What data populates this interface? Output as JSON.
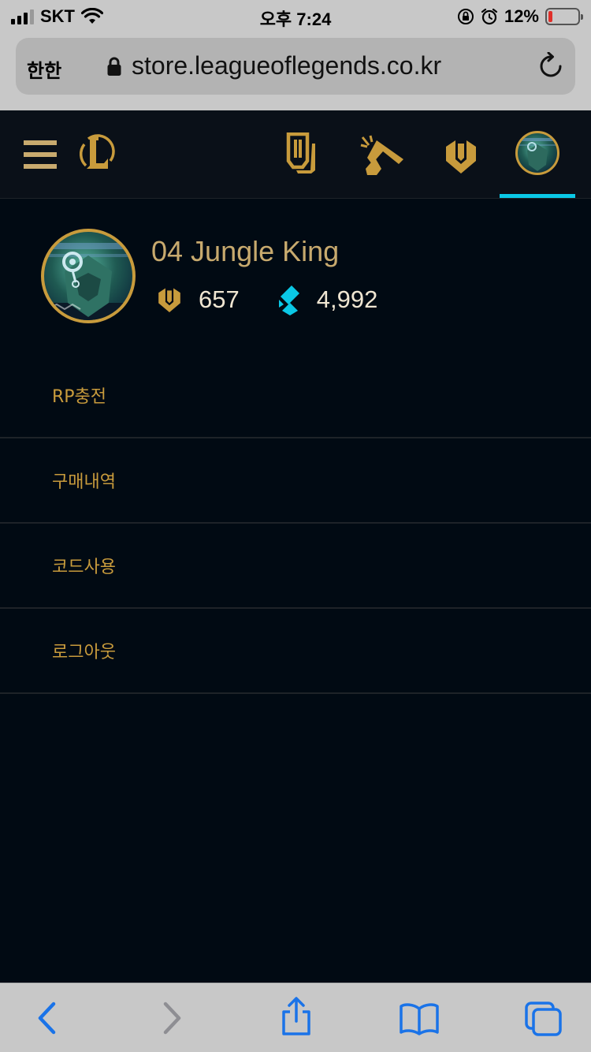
{
  "status_bar": {
    "carrier": "SKT",
    "time": "오후 7:24",
    "battery_percent": "12%",
    "battery_level": 0.12
  },
  "browser": {
    "text_size_label": "한한",
    "url": "store.leagueoflegends.co.kr"
  },
  "nav": {
    "items": [
      {
        "icon": "menu-icon"
      },
      {
        "icon": "league-logo-icon"
      },
      {
        "icon": "collection-icon"
      },
      {
        "icon": "hextech-crafting-icon"
      },
      {
        "icon": "rp-icon"
      },
      {
        "icon": "profile-avatar-icon",
        "active": true
      }
    ]
  },
  "profile": {
    "username": "04 Jungle King",
    "rp": "657",
    "essence": "4,992"
  },
  "menu": {
    "items": [
      {
        "label": "RP충전"
      },
      {
        "label": "구매내역"
      },
      {
        "label": "코드사용"
      },
      {
        "label": "로그아웃"
      }
    ]
  },
  "colors": {
    "gold": "#c89b3c",
    "gold_text": "#c8aa6e",
    "cyan_accent": "#0ac8e6",
    "background": "#010a13",
    "ios_blue": "#1a73e8"
  }
}
